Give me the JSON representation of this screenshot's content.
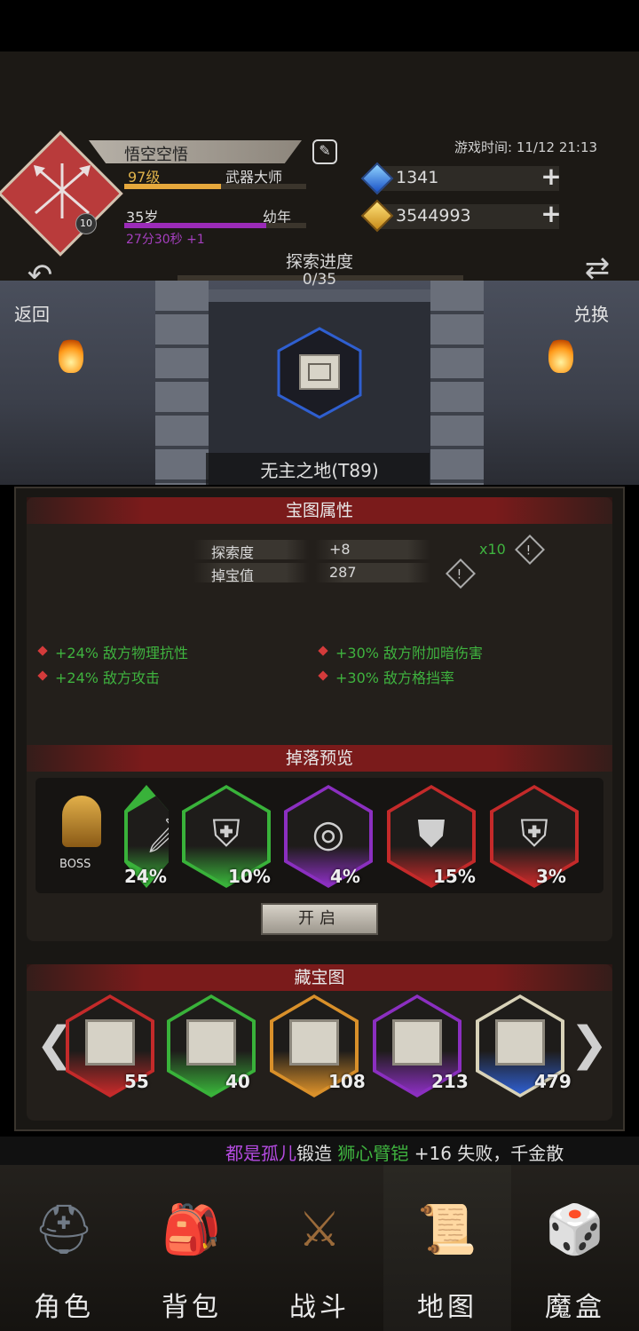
{
  "player": {
    "name": "悟空空悟",
    "avatar_level": "10",
    "level": "97级",
    "title": "武器大师",
    "age": "35岁",
    "stage": "幼年",
    "timer": "27分30秒 +1",
    "exp_progress": 0.53,
    "age_progress": 0.78
  },
  "game_time": "游戏时间: 11/12 21:13",
  "currency": {
    "gems": "1341",
    "gold": "3544993"
  },
  "explore": {
    "label": "探索进度",
    "value": "0/35",
    "progress": 0.0
  },
  "nav_top": {
    "back": "返回",
    "exchange": "兑换"
  },
  "map_name": "无主之地(T89)",
  "sections": {
    "attributes": "宝图属性",
    "drops": "掉落预览",
    "chests": "藏宝图"
  },
  "stats": [
    {
      "label": "探索度",
      "value": "+8"
    },
    {
      "label": "掉宝值",
      "value": "287"
    }
  ],
  "multiplier": "x10",
  "affixes": [
    "+24% 敌方物理抗性",
    "+30% 敌方附加暗伤害",
    "+24% 敌方攻击",
    "+30% 敌方格挡率"
  ],
  "boss_label": "BOSS",
  "drops": [
    {
      "pct": "24%",
      "rarity": "green",
      "icon": "dagger-icon"
    },
    {
      "pct": "10%",
      "rarity": "green",
      "icon": "armor-icon"
    },
    {
      "pct": "4%",
      "rarity": "purple",
      "icon": "belt-icon"
    },
    {
      "pct": "15%",
      "rarity": "red",
      "icon": "shield-icon"
    },
    {
      "pct": "3%",
      "rarity": "red",
      "icon": "armor-icon"
    }
  ],
  "open_button": "开启",
  "chest_maps": [
    {
      "count": "55",
      "rarity": "red"
    },
    {
      "count": "40",
      "rarity": "green"
    },
    {
      "count": "108",
      "rarity": "orange"
    },
    {
      "count": "213",
      "rarity": "purple"
    },
    {
      "count": "479",
      "rarity": "blue",
      "selected": true
    }
  ],
  "ticker": {
    "player": "都是孤儿",
    "action": "锻造",
    "item": "狮心臂铠",
    "rest": "+16 失败，千金散"
  },
  "colors": {
    "green": "#39b23a",
    "purple": "#8b2fc0",
    "red": "#c42a2a",
    "orange": "#d9902a",
    "blue": "#2f5fd0"
  },
  "bottom_nav": [
    {
      "label": "角色",
      "icon": "helmet-icon"
    },
    {
      "label": "背包",
      "icon": "backpack-icon"
    },
    {
      "label": "战斗",
      "icon": "sword-shield-icon"
    },
    {
      "label": "地图",
      "icon": "scroll-map-icon",
      "active": true
    },
    {
      "label": "魔盒",
      "icon": "magic-box-icon"
    }
  ]
}
